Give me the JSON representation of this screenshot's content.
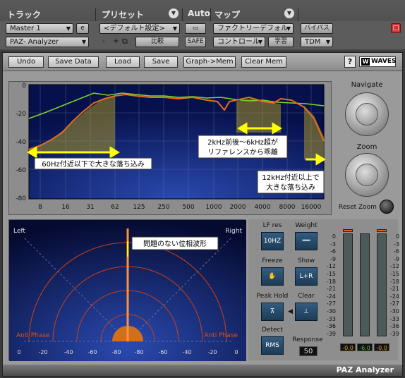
{
  "header": {
    "track_label": "トラック",
    "preset_label": "プリセット",
    "auto_label": "Auto",
    "map_label": "マップ",
    "track_name": "Master 1",
    "track_e": "e",
    "plugin_name": "PAZ- Analyzer",
    "preset_value": "<デフォルト設定>",
    "preset_minus": "-",
    "preset_plus": "+",
    "compare_label": "比較",
    "safe_label": "SAFE",
    "map_value": "ファクトリーデフォル",
    "control_value": "コントロール",
    "learn_label": "学習",
    "bypass_label": "バイパス",
    "tdm_label": "TDM"
  },
  "toolbar": {
    "buttons": [
      "Undo",
      "Save Data",
      "Load",
      "Save",
      "Graph->Mem",
      "Clear Mem"
    ],
    "help_label": "?",
    "logo_text": "WAVES",
    "logo_mark": "W"
  },
  "spectrum": {
    "y_ticks": [
      "0",
      "-20",
      "-40",
      "-60",
      "-80"
    ],
    "x_ticks": [
      "8",
      "16",
      "31",
      "62",
      "125",
      "250",
      "500",
      "1000",
      "2000",
      "4000",
      "8000",
      "16000"
    ],
    "annotation_low": "60Hz付近以下で大きな落ち込み",
    "annotation_mid_line1": "2kHz前後～6kHz超が",
    "annotation_mid_line2": "リファレンスから乖離",
    "annotation_high_line1": "12kHz付近以上で",
    "annotation_high_line2": "大きな落ち込み",
    "colors": {
      "orange": "#e0701a",
      "green": "#7ed42a",
      "bg": "#0a1a5a",
      "highlight": "#ffff00"
    }
  },
  "navigate": {
    "navigate_label": "Navigate",
    "zoom_label": "Zoom",
    "reset_zoom_label": "Reset Zoom"
  },
  "phase": {
    "left_label": "Left",
    "right_label": "Right",
    "anti_phase_left": "Anti Phase",
    "anti_phase_right": "Anti Phase",
    "annotation": "問題のない位相波形",
    "x_ticks": [
      "0",
      "-20",
      "-40",
      "-60",
      "-80",
      "-80",
      "-60",
      "-40",
      "-20",
      "0"
    ]
  },
  "controls": {
    "lf_res_label": "LF res",
    "lf_res_value": "10HZ",
    "weight_label": "Weight",
    "freeze_label": "Freeze",
    "show_label": "Show",
    "show_value": "L+R",
    "peak_hold_label": "Peak Hold",
    "clear_label": "Clear",
    "detect_label": "Detect",
    "detect_value": "RMS",
    "response_label": "Response",
    "response_value": "50"
  },
  "meters": {
    "scale": [
      "0",
      "-3",
      "-6",
      "-9",
      "-12",
      "-15",
      "-18",
      "-21",
      "-24",
      "-27",
      "-30",
      "-33",
      "-36",
      "-39"
    ],
    "readouts": [
      "-0.0",
      "-6.0",
      "-0.0"
    ],
    "peak_color": "#e06020"
  },
  "footer": {
    "title": "PAZ Analyzer"
  }
}
